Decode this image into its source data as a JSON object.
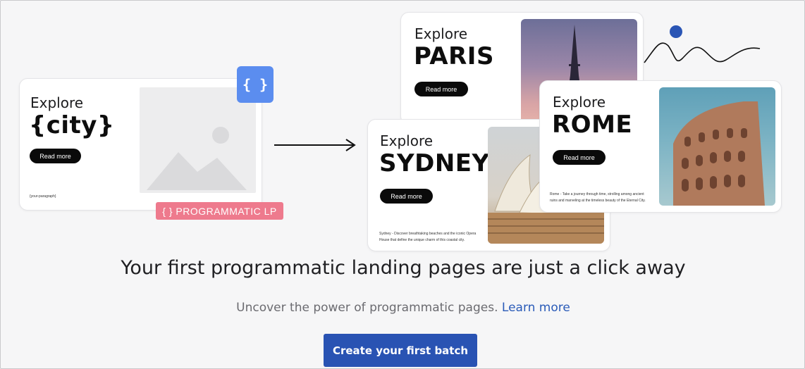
{
  "template_card": {
    "explore": "Explore",
    "city": "{city}",
    "read_more": "Read more",
    "paragraph": "{your-paragraph}",
    "image_icon": "image-placeholder-icon"
  },
  "badges": {
    "braces": "{ }",
    "programmatic_lp": "{ } PROGRAMMATIC LP"
  },
  "cards": {
    "paris": {
      "explore": "Explore",
      "city": "PARIS",
      "read_more": "Read more"
    },
    "rome": {
      "explore": "Explore",
      "city": "ROME",
      "read_more": "Read more",
      "paragraph": "Rome - Take a journey through time, strolling among ancient ruins and marveling at the timeless beauty of the Eternal City."
    },
    "sydney": {
      "explore": "Explore",
      "city": "SYDNEY",
      "read_more": "Read more",
      "paragraph": "Sydney - Discover breathtaking beaches and the iconic Opera House that define the unique charm of this coastal city."
    }
  },
  "headline": "Your first programmatic landing pages are just a click away",
  "subline": {
    "text": "Uncover the power of programmatic pages.",
    "link": "Learn more"
  },
  "cta_label": "Create your first batch",
  "colors": {
    "accent_blue": "#2953b3",
    "badge_blue": "#5b8def",
    "badge_pink": "#ee7a8d",
    "dot_blue": "#2a55b5"
  }
}
